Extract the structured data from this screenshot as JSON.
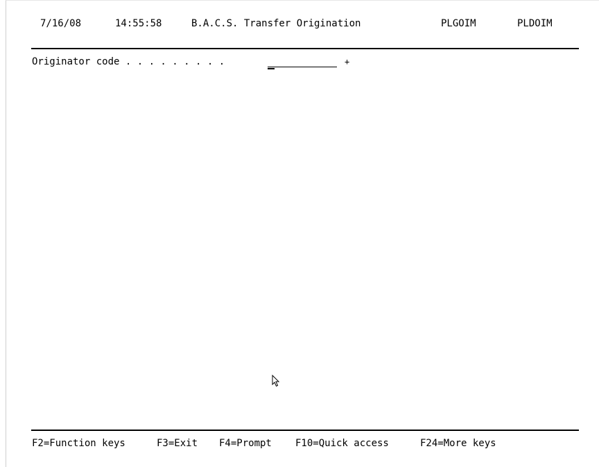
{
  "header": {
    "date": "7/16/08",
    "time": "14:55:58",
    "title": "B.A.C.S. Transfer Origination",
    "program": "PLGOIM",
    "display": "PLDOIM"
  },
  "form": {
    "originator_label": "Originator code . . . . . . . . .",
    "originator_value": "",
    "prompt_indicator": "+"
  },
  "footer": {
    "f2": "F2=Function keys",
    "f3": "F3=Exit",
    "f4": "F4=Prompt",
    "f10": "F10=Quick access",
    "f24": "F24=More keys"
  },
  "icons": {
    "pointer": "mouse-pointer-icon"
  }
}
